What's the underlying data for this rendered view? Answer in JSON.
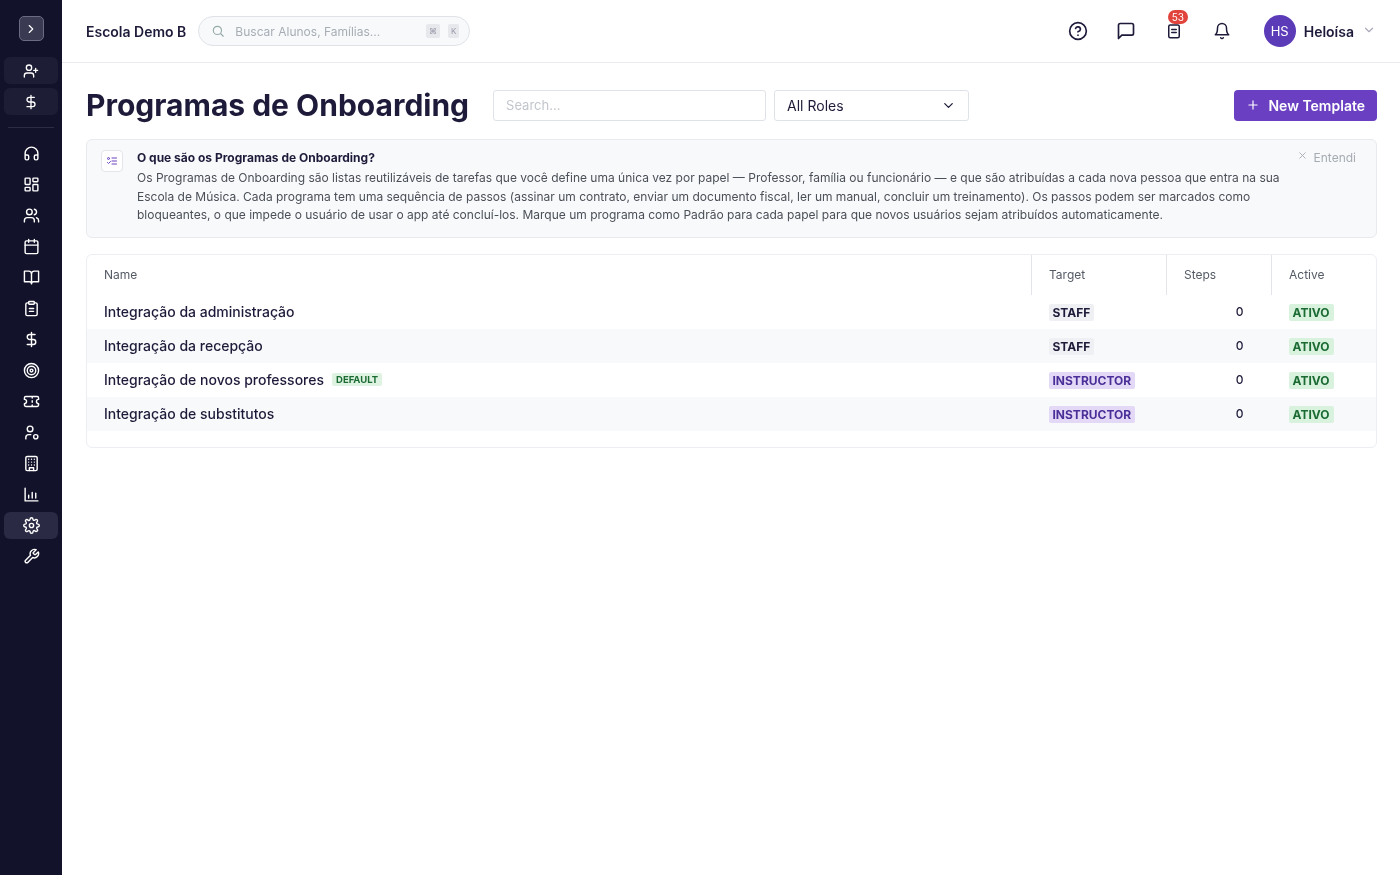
{
  "sidebar": {
    "quick_actions": [
      {
        "selected": false
      },
      {
        "selected": false
      }
    ],
    "items": [
      {
        "selected": false
      },
      {
        "selected": false
      },
      {
        "selected": false
      },
      {
        "selected": false
      },
      {
        "selected": false
      },
      {
        "selected": false
      },
      {
        "selected": false
      },
      {
        "selected": false
      },
      {
        "selected": false
      },
      {
        "selected": false
      },
      {
        "selected": false
      },
      {
        "selected": false
      },
      {
        "selected": true
      },
      {
        "selected": false
      }
    ]
  },
  "header": {
    "school": "Escola Demo B",
    "search": {
      "placeholder": "Buscar Alunos, Famílias...",
      "keys": [
        "⌘",
        "K"
      ]
    },
    "tasks_badge": "53",
    "avatar": "HS",
    "user": "Heloísa"
  },
  "page": {
    "title": "Programas de Onboarding",
    "search": {
      "placeholder": "Search..."
    },
    "role_filter": "All Roles",
    "new_button": "New Template"
  },
  "info": {
    "title": "O que são os Programas de Onboarding?",
    "text": "Os Programas de Onboarding são listas reutilizáveis de tarefas que você define uma única vez por papel — Professor, família ou funcionário — e que são atribuídas a cada nova pessoa que entra na sua Escola de Música. Cada programa tem uma sequência de passos (assinar um contrato, enviar um documento fiscal, ler um manual, concluir um treinamento). Os passos podem ser marcados como bloqueantes, o que impede o usuário de usar o app até concluí-los. Marque um programa como Padrão para cada papel para que novos usuários sejam atribuídos automaticamente.",
    "dismiss": "Entendi"
  },
  "table": {
    "columns": [
      "Name",
      "Target",
      "Steps",
      "Active"
    ],
    "rows": [
      {
        "name": "Integração da administração",
        "target": {
          "label": "STAFF",
          "kind": "staff"
        },
        "steps": "0",
        "active": "ATIVO"
      },
      {
        "name": "Integração da recepção",
        "target": {
          "label": "STAFF",
          "kind": "staff"
        },
        "steps": "0",
        "active": "ATIVO"
      },
      {
        "name": "Integração de novos professores",
        "badge": "DEFAULT",
        "target": {
          "label": "INSTRUCTOR",
          "kind": "instructor"
        },
        "steps": "0",
        "active": "ATIVO"
      },
      {
        "name": "Integração de substitutos",
        "target": {
          "label": "INSTRUCTOR",
          "kind": "instructor"
        },
        "steps": "0",
        "active": "ATIVO"
      }
    ]
  }
}
